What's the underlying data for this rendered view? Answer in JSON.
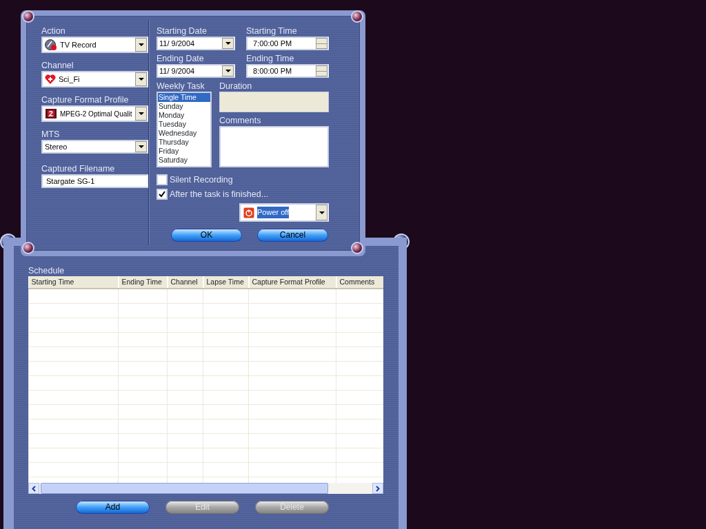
{
  "schedule_dialog": {
    "left_fields": [
      {
        "label": "Action",
        "kind": "combo",
        "value": "TV Record"
      },
      {
        "label": "Channel",
        "kind": "combo",
        "value": "Sci_Fi"
      },
      {
        "label": "Capture Format Profile",
        "kind": "combo",
        "value": "MPEG-2 Optimal Qualit"
      },
      {
        "label": "MTS",
        "kind": "combo",
        "value": "Stereo"
      },
      {
        "label": "Captured Filename",
        "kind": "text",
        "value": "Stargate SG-1"
      }
    ],
    "date_time": [
      {
        "label": "Starting Date",
        "kind": "date",
        "value": "11/ 9/2004"
      },
      {
        "label": "Starting Time",
        "kind": "time",
        "value": "7:00:00 PM"
      },
      {
        "label": "Ending Date",
        "kind": "date",
        "value": "11/ 9/2004"
      },
      {
        "label": "Ending Time",
        "kind": "time",
        "value": "8:00:00 PM"
      }
    ],
    "weekly_task": {
      "label": "Weekly Task",
      "items": [
        {
          "label": "Single Time",
          "selected": true
        },
        {
          "label": "Sunday",
          "selected": false
        },
        {
          "label": "Monday",
          "selected": false
        },
        {
          "label": "Tuesday",
          "selected": false
        },
        {
          "label": "Wednesday",
          "selected": false
        },
        {
          "label": "Thursday",
          "selected": false
        },
        {
          "label": "Friday",
          "selected": false
        },
        {
          "label": "Saturday",
          "selected": false
        }
      ]
    },
    "duration": {
      "label": "Duration"
    },
    "comments": {
      "label": "Comments"
    },
    "options": [
      {
        "label": "Silent Recording",
        "checked": false
      },
      {
        "label": "After the task is finished...",
        "checked": true
      }
    ],
    "after_action": {
      "value": "Power off",
      "highlighted": true
    },
    "buttons": [
      {
        "label": "OK"
      },
      {
        "label": "Cancel"
      }
    ]
  },
  "schedule_window": {
    "title": "Schedule",
    "columns": [
      "Starting Time",
      "Ending Time",
      "Channel",
      "Lapse Time",
      "Capture Format Profile",
      "Comments"
    ],
    "buttons": [
      {
        "label": "Add",
        "disabled": false
      },
      {
        "label": "Edit",
        "disabled": true
      },
      {
        "label": "Delete",
        "disabled": true
      }
    ]
  }
}
